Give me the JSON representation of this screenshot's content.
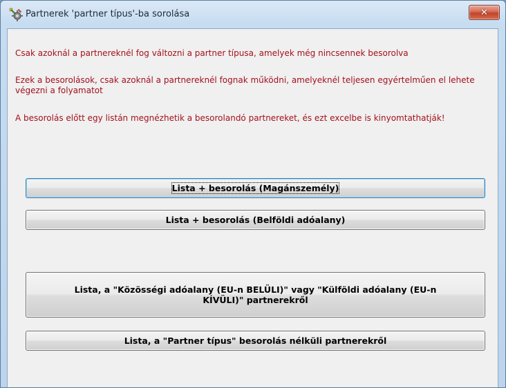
{
  "window": {
    "title": "Partnerek 'partner típus'-ba sorolása",
    "close_label": "✕",
    "app_icon": "gear-wrench-icon",
    "colors": {
      "title_bar": "#c6dcf1",
      "close_button": "#c2442a",
      "message_text": "#a3101c",
      "client_bg": "#f0f0f0"
    }
  },
  "messages": [
    "Csak azoknál a partnereknél fog változni a partner típusa, amelyek még nincsennek besorolva",
    "Ezek a besorolások, csak azoknál a partnereknél fognak működni, amelyeknél teljesen egyértelműen el lehete végezni a folyamatot",
    "A besorolás előtt egy listán megnézhetik a besorolandó partnereket, és ezt excelbe is kinyomtathatják!"
  ],
  "buttons": {
    "maganszemely": "Lista + besorolás (Magánszemély)",
    "belfoldi": "Lista + besorolás (Belföldi adóalany)",
    "kozossegi": "Lista, a \"Közösségi adóalany (EU-n BELÜLI)\" vagy \"Külföldi adóalany (EU-n KÍVÜLI)\" partnerekről",
    "besorolas_nelkuli": "Lista, a \"Partner típus\" besorolás nélküli partnerekről"
  }
}
